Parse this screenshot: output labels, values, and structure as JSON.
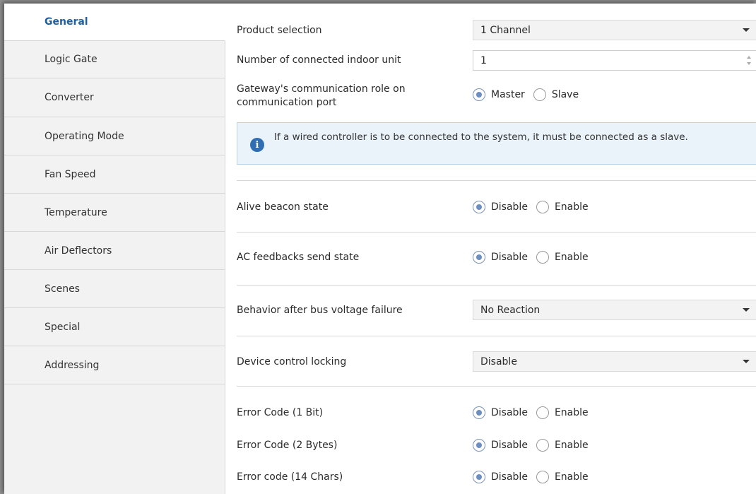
{
  "sidebar": {
    "items": [
      {
        "label": "General",
        "active": true
      },
      {
        "label": "Logic Gate"
      },
      {
        "label": "Converter"
      },
      {
        "label": "Operating Mode"
      },
      {
        "label": "Fan Speed"
      },
      {
        "label": "Temperature"
      },
      {
        "label": "Air Deflectors"
      },
      {
        "label": "Scenes"
      },
      {
        "label": "Special"
      },
      {
        "label": "Addressing"
      }
    ]
  },
  "general": {
    "product_selection": {
      "label": "Product selection",
      "value": "1 Channel"
    },
    "indoor_units": {
      "label": "Number of connected indoor unit",
      "value": "1"
    },
    "comm_role": {
      "label_line1": "Gateway's communication role on",
      "label_line2": "communication port",
      "options": [
        "Master",
        "Slave"
      ],
      "selected": "Master"
    },
    "info_message": "If a wired controller is to be connected to the system, it must be connected as a slave.",
    "alive_beacon": {
      "label": "Alive beacon state",
      "options": [
        "Disable",
        "Enable"
      ],
      "selected": "Disable"
    },
    "ac_feedbacks": {
      "label": "AC feedbacks send state",
      "options": [
        "Disable",
        "Enable"
      ],
      "selected": "Disable"
    },
    "bus_failure": {
      "label": "Behavior after bus voltage failure",
      "value": "No Reaction"
    },
    "control_locking": {
      "label": "Device control locking",
      "value": "Disable"
    },
    "error_1bit": {
      "label": "Error Code (1 Bit)",
      "options": [
        "Disable",
        "Enable"
      ],
      "selected": "Disable"
    },
    "error_2bytes": {
      "label": "Error Code (2 Bytes)",
      "options": [
        "Disable",
        "Enable"
      ],
      "selected": "Disable"
    },
    "error_14chars": {
      "label": "Error code (14 Chars)",
      "options": [
        "Disable",
        "Enable"
      ],
      "selected": "Disable"
    }
  },
  "colors": {
    "accent": "#1f5fa0",
    "info_bg": "#eaf2fa",
    "radio_on": "#6d8fbf"
  }
}
